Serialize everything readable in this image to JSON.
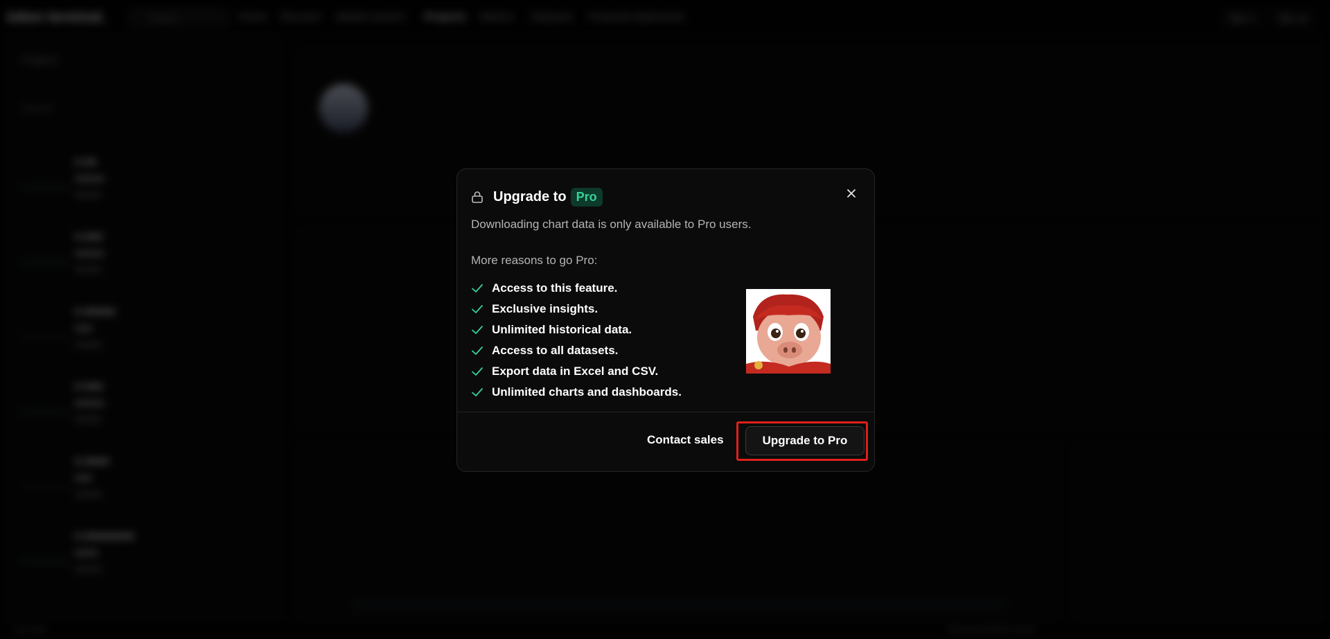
{
  "app": {
    "brand": "token terminal_",
    "search_label": "Search",
    "nav": [
      "Home",
      "Discover",
      "Market sectors",
      "Projects",
      "Metrics",
      "Datasets",
      "Financial statements"
    ],
    "top_buttons": [
      "Sign in",
      "Sign up"
    ],
    "sidebar_title": "Projects",
    "sidebar_search": "Search",
    "bottom_left": "Last 30d",
    "bottom_right": "Download Market sheet"
  },
  "modal": {
    "title": "Upgrade to",
    "badge": "Pro",
    "description": "Downloading chart data is only available to Pro users.",
    "reasons_title": "More reasons to go Pro:",
    "reasons": [
      "Access to this feature.",
      "Exclusive insights.",
      "Unlimited historical data.",
      "Access to all datasets.",
      "Export data in Excel and CSV.",
      "Unlimited charts and dashboards."
    ],
    "contact_label": "Contact sales",
    "upgrade_label": "Upgrade to Pro",
    "accent_color": "#35d39a",
    "highlight_color": "#e0201a"
  }
}
